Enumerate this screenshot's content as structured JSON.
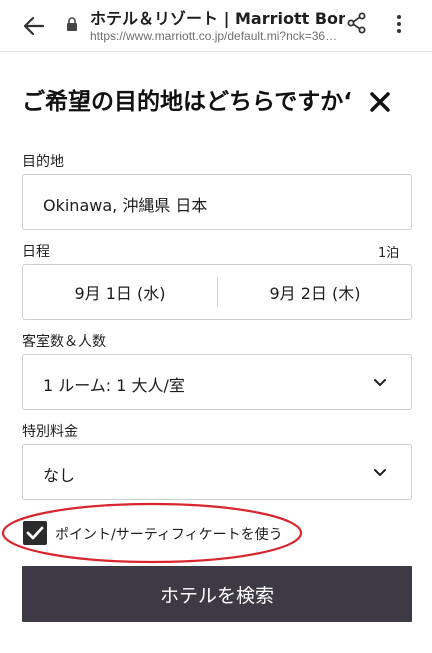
{
  "browser": {
    "tab_title": "ホテル＆リゾート | Marriott Bon…",
    "url": "https://www.marriott.co.jp/default.mi?nck=36…"
  },
  "dialog": {
    "heading": "ご希望の目的地はどちらですか‘"
  },
  "destination": {
    "label": "目的地",
    "value": "Okinawa, 沖縄県 日本"
  },
  "dates": {
    "label": "日程",
    "nights": "1泊",
    "check_in": "9月 1日 (水)",
    "check_out": "9月 2日 (木)"
  },
  "rooms_guests": {
    "label": "客室数＆人数",
    "value": "1 ルーム: 1 大人/室"
  },
  "special_rates": {
    "label": "特別料金",
    "value": "なし"
  },
  "points_checkbox": {
    "label": "ポイント/サーティフィケートを使う",
    "checked": true
  },
  "search_button": {
    "label": "ホテルを検索"
  },
  "colors": {
    "button_bg": "#3d3a45",
    "annotation": "#d9262e",
    "checkbox": "#2b2b2b"
  },
  "icons": [
    "back-arrow-icon",
    "lock-icon",
    "share-icon",
    "more-vert-icon",
    "close-icon",
    "chevron-down-icon",
    "checkmark-icon"
  ]
}
